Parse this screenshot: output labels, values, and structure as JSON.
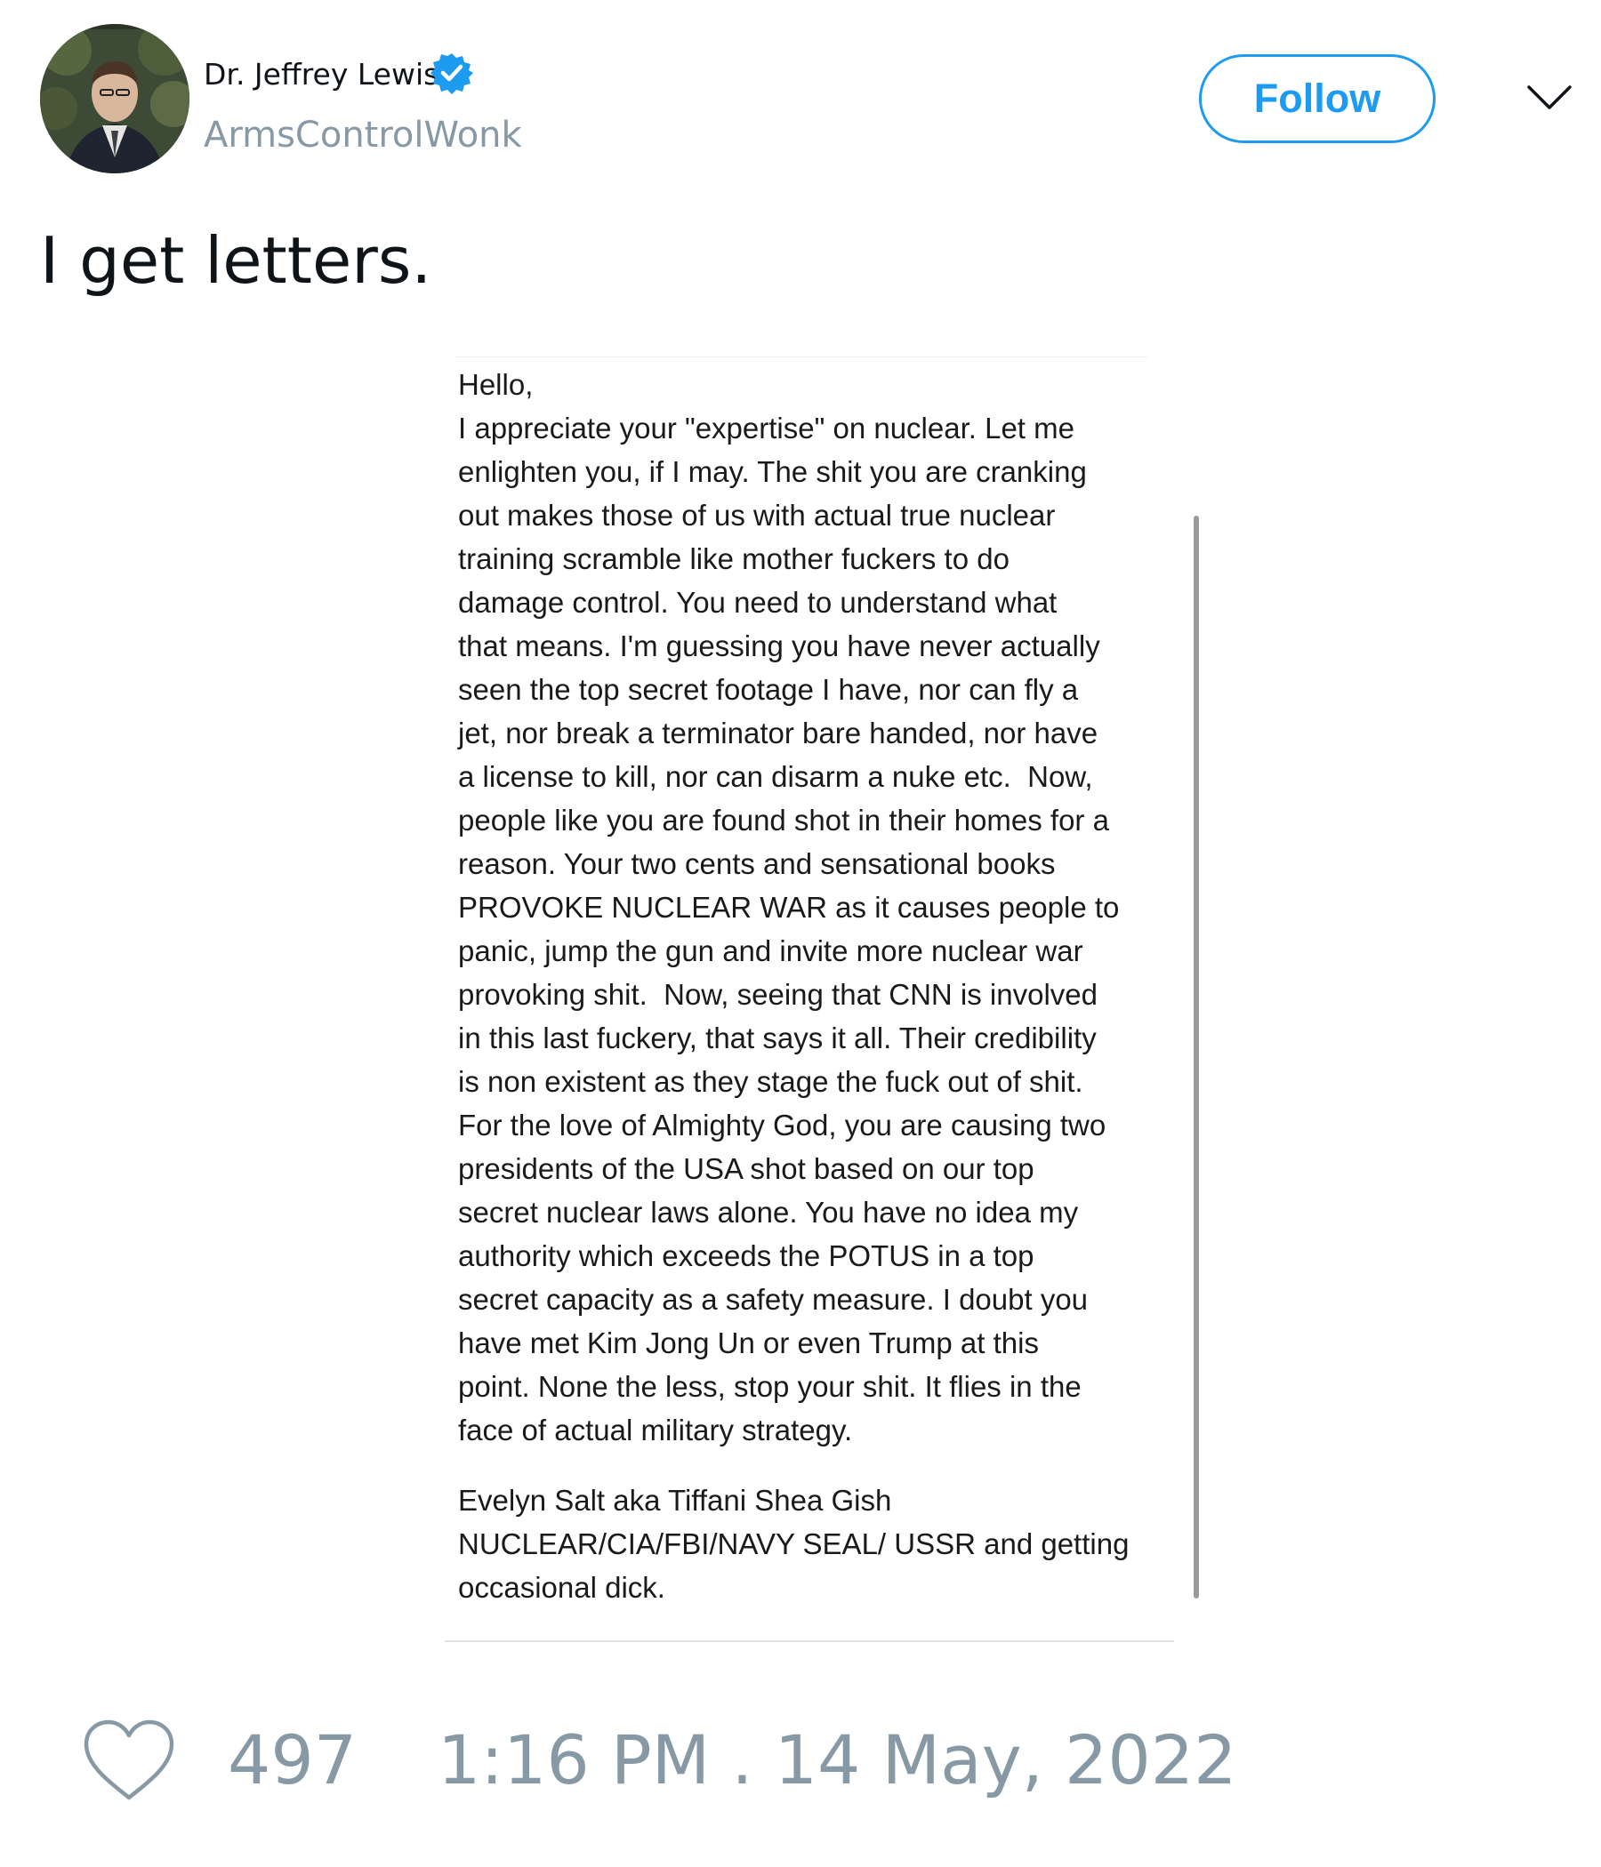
{
  "author": {
    "display_name": "Dr. Jeffrey Lewis",
    "handle": "ArmsControlWonk",
    "verified": true,
    "avatar_icon": "profile-photo"
  },
  "follow_button": {
    "label": "Follow"
  },
  "menu": {
    "icon": "chevron-down-icon"
  },
  "tweet": {
    "text": "I get letters."
  },
  "letter": {
    "lines": [
      "Hello,",
      "I appreciate your \"expertise\" on nuclear. Let me",
      "enlighten you, if I may. The shit you are cranking",
      "out makes those of us with actual true nuclear",
      "training scramble like mother fuckers to do",
      "damage control. You need to understand what",
      "that means. I'm guessing you have never actually",
      "seen the top secret footage I have, nor can fly a",
      "jet, nor break a terminator bare handed, nor have",
      "a license to kill, nor can disarm a nuke etc.  Now,",
      "people like you are found shot in their homes for a",
      "reason. Your two cents and sensational books",
      "PROVOKE NUCLEAR WAR as it causes people to",
      "panic, jump the gun and invite more nuclear war",
      "provoking shit.  Now, seeing that CNN is involved",
      "in this last fuckery, that says it all. Their credibility",
      "is non existent as they stage the fuck out of shit.",
      "For the love of Almighty God, you are causing two",
      "presidents of the USA shot based on our top",
      "secret nuclear laws alone. You have no idea my",
      "authority which exceeds the POTUS in a top",
      "secret capacity as a safety measure. I doubt you",
      "have met Kim Jong Un or even Trump at this",
      "point. None the less, stop your shit. It flies in the",
      "face of actual military strategy."
    ],
    "signature": [
      "Evelyn Salt aka Tiffani Shea Gish",
      "NUCLEAR/CIA/FBI/NAVY SEAL/ USSR and getting",
      "occasional dick."
    ]
  },
  "footer": {
    "like_icon": "heart-icon",
    "like_count": "497",
    "timestamp": "1:16 PM . 14 May, 2022"
  },
  "colors": {
    "accent": "#1d9bf0",
    "muted": "#8899a6",
    "text": "#0f1419"
  }
}
